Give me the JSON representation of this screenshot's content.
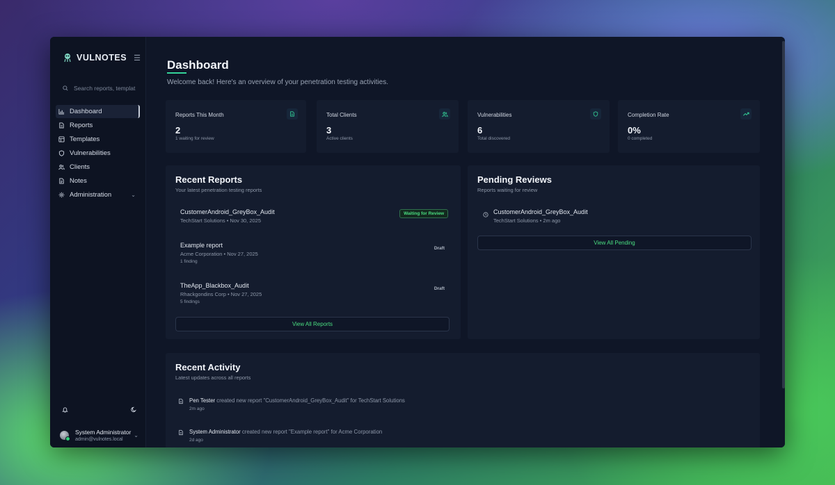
{
  "brand": {
    "name": "VULNOTES"
  },
  "search": {
    "placeholder": "Search reports, templat"
  },
  "sidebar": {
    "items": [
      {
        "label": "Dashboard",
        "icon": "bar-chart-icon",
        "active": true
      },
      {
        "label": "Reports",
        "icon": "file-icon"
      },
      {
        "label": "Templates",
        "icon": "template-icon"
      },
      {
        "label": "Vulnerabilities",
        "icon": "shield-icon"
      },
      {
        "label": "Clients",
        "icon": "users-icon"
      },
      {
        "label": "Notes",
        "icon": "notes-icon"
      },
      {
        "label": "Administration",
        "icon": "gear-icon",
        "expandable": true
      }
    ]
  },
  "user": {
    "name": "System Administrator",
    "email": "admin@vulnotes.local"
  },
  "page": {
    "title": "Dashboard",
    "subtitle": "Welcome back! Here's an overview of your penetration testing activities."
  },
  "stats": [
    {
      "label": "Reports This Month",
      "value": "2",
      "note": "1 waiting for review",
      "icon": "file-icon"
    },
    {
      "label": "Total Clients",
      "value": "3",
      "note": "Active clients",
      "icon": "users-icon"
    },
    {
      "label": "Vulnerabilities",
      "value": "6",
      "note": "Total discovered",
      "icon": "shield-icon"
    },
    {
      "label": "Completion Rate",
      "value": "0%",
      "note": "0 completed",
      "icon": "trending-up-icon"
    }
  ],
  "recent_reports": {
    "title": "Recent Reports",
    "subtitle": "Your latest penetration testing reports",
    "items": [
      {
        "name": "CustomerAndroid_GreyBox_Audit",
        "meta": "TechStart Solutions • Nov 30, 2025",
        "findings": "",
        "status": "Waiting for Review"
      },
      {
        "name": "Example report",
        "meta": "Acme Corporation • Nov 27, 2025",
        "findings": "1 finding",
        "status": "Draft"
      },
      {
        "name": "TheApp_Blackbox_Audit",
        "meta": "Rhackgondins Corp • Nov 27, 2025",
        "findings": "5 findings",
        "status": "Draft"
      }
    ],
    "button": "View All Reports"
  },
  "pending_reviews": {
    "title": "Pending Reviews",
    "subtitle": "Reports waiting for review",
    "items": [
      {
        "name": "CustomerAndroid_GreyBox_Audit",
        "meta": "TechStart Solutions • 2m ago"
      }
    ],
    "button": "View All Pending"
  },
  "recent_activity": {
    "title": "Recent Activity",
    "subtitle": "Latest updates across all reports",
    "items": [
      {
        "who": "Pen Tester",
        "text": " created new report \"CustomerAndroid_GreyBox_Audit\" for TechStart Solutions",
        "time": "2m ago"
      },
      {
        "who": "System Administrator",
        "text": " created new report \"Example report\" for Acme Corporation",
        "time": "2d ago"
      }
    ]
  },
  "colors": {
    "accent": "#34d399",
    "background": "#0f1627",
    "card": "#141c2e"
  }
}
